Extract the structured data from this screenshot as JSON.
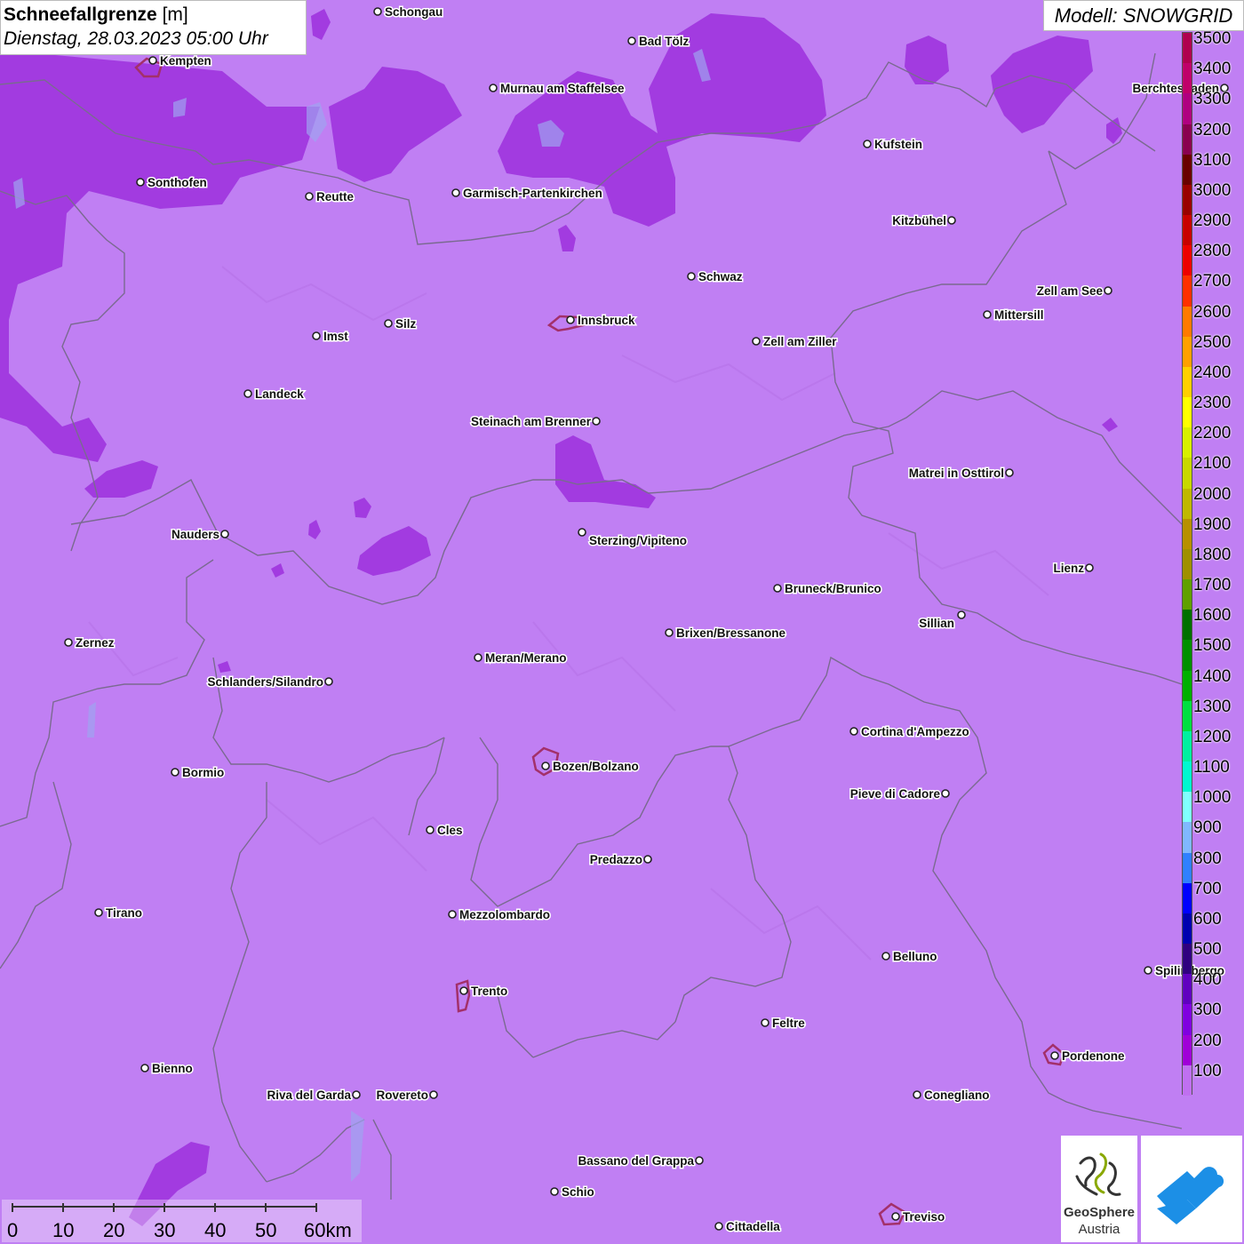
{
  "header": {
    "title_main": "Schneefallgrenze",
    "title_unit": "[m]",
    "datetime": "Dienstag, 28.03.2023 05:00 Uhr",
    "model": "Modell: SNOWGRID"
  },
  "legend": {
    "levels": [
      {
        "label": "3500",
        "color": "#b0004f"
      },
      {
        "label": "3400",
        "color": "#c0006a"
      },
      {
        "label": "3300",
        "color": "#b00080"
      },
      {
        "label": "3200",
        "color": "#8a0050"
      },
      {
        "label": "3100",
        "color": "#6a0000"
      },
      {
        "label": "3000",
        "color": "#9a0000"
      },
      {
        "label": "2900",
        "color": "#c80000"
      },
      {
        "label": "2800",
        "color": "#ee0000"
      },
      {
        "label": "2700",
        "color": "#ff3000"
      },
      {
        "label": "2600",
        "color": "#ff7a00"
      },
      {
        "label": "2500",
        "color": "#ffa000"
      },
      {
        "label": "2400",
        "color": "#ffd000"
      },
      {
        "label": "2300",
        "color": "#ffff00"
      },
      {
        "label": "2200",
        "color": "#d8f000"
      },
      {
        "label": "2100",
        "color": "#c8d800"
      },
      {
        "label": "2000",
        "color": "#c0b800"
      },
      {
        "label": "1900",
        "color": "#b89000"
      },
      {
        "label": "1800",
        "color": "#a09000"
      },
      {
        "label": "1700",
        "color": "#60a000"
      },
      {
        "label": "1600",
        "color": "#007000"
      },
      {
        "label": "1500",
        "color": "#009000"
      },
      {
        "label": "1400",
        "color": "#00b000"
      },
      {
        "label": "1300",
        "color": "#00e040"
      },
      {
        "label": "1200",
        "color": "#00f0a0"
      },
      {
        "label": "1100",
        "color": "#00f8d0"
      },
      {
        "label": "1000",
        "color": "#80ffff"
      },
      {
        "label": "900",
        "color": "#80b8ff"
      },
      {
        "label": "800",
        "color": "#3080ff"
      },
      {
        "label": "700",
        "color": "#0000ff"
      },
      {
        "label": "600",
        "color": "#0000b0"
      },
      {
        "label": "500",
        "color": "#300080"
      },
      {
        "label": "400",
        "color": "#6000c0"
      },
      {
        "label": "300",
        "color": "#8000e0"
      },
      {
        "label": "200",
        "color": "#a000d8"
      },
      {
        "label": "100",
        "color": "#c070f0"
      }
    ]
  },
  "scale_bar": {
    "ticks": [
      "0",
      "10",
      "20",
      "30",
      "40",
      "50",
      "60km"
    ]
  },
  "cities": [
    {
      "name": "Schongau"
    },
    {
      "name": "Bad Tölz"
    },
    {
      "name": "Kempten"
    },
    {
      "name": "Murnau am Staffelsee"
    },
    {
      "name": "Berchtesgaden"
    },
    {
      "name": "Kufstein"
    },
    {
      "name": "Sonthofen"
    },
    {
      "name": "Reutte"
    },
    {
      "name": "Garmisch-Partenkirchen"
    },
    {
      "name": "Kitzbühel"
    },
    {
      "name": "Schwaz"
    },
    {
      "name": "Zell am See"
    },
    {
      "name": "Innsbruck"
    },
    {
      "name": "Mittersill"
    },
    {
      "name": "Silz"
    },
    {
      "name": "Imst"
    },
    {
      "name": "Zell am Ziller"
    },
    {
      "name": "Landeck"
    },
    {
      "name": "Steinach am Brenner"
    },
    {
      "name": "Matrei in Osttirol"
    },
    {
      "name": "Nauders"
    },
    {
      "name": "Sterzing/Vipiteno"
    },
    {
      "name": "Lienz"
    },
    {
      "name": "Bruneck/Brunico"
    },
    {
      "name": "Sillian"
    },
    {
      "name": "Brixen/Bressanone"
    },
    {
      "name": "Zernez"
    },
    {
      "name": "Meran/Merano"
    },
    {
      "name": "Schlanders/Silandro"
    },
    {
      "name": "Cortina d'Ampezzo"
    },
    {
      "name": "Bozen/Bolzano"
    },
    {
      "name": "Bormio"
    },
    {
      "name": "Pieve di Cadore"
    },
    {
      "name": "Cles"
    },
    {
      "name": "Predazzo"
    },
    {
      "name": "Tirano"
    },
    {
      "name": "Mezzolombardo"
    },
    {
      "name": "Belluno"
    },
    {
      "name": "Spilimbergo"
    },
    {
      "name": "Trento"
    },
    {
      "name": "Feltre"
    },
    {
      "name": "Pordenone"
    },
    {
      "name": "Bienno"
    },
    {
      "name": "Riva del Garda"
    },
    {
      "name": "Rovereto"
    },
    {
      "name": "Conegliano"
    },
    {
      "name": "Bassano del Grappa"
    },
    {
      "name": "Schio"
    },
    {
      "name": "Treviso"
    },
    {
      "name": "Cittadella"
    }
  ],
  "logos": {
    "geosphere_line1": "GeoSphere",
    "geosphere_line2": "Austria"
  }
}
